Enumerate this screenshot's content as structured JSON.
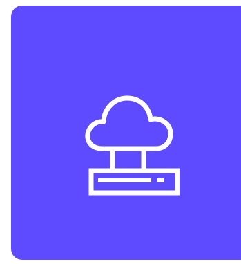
{
  "tile": {
    "icon": "cloud-server-icon",
    "background_color": "#5E4BFF",
    "icon_color": "#FFFFFF"
  }
}
